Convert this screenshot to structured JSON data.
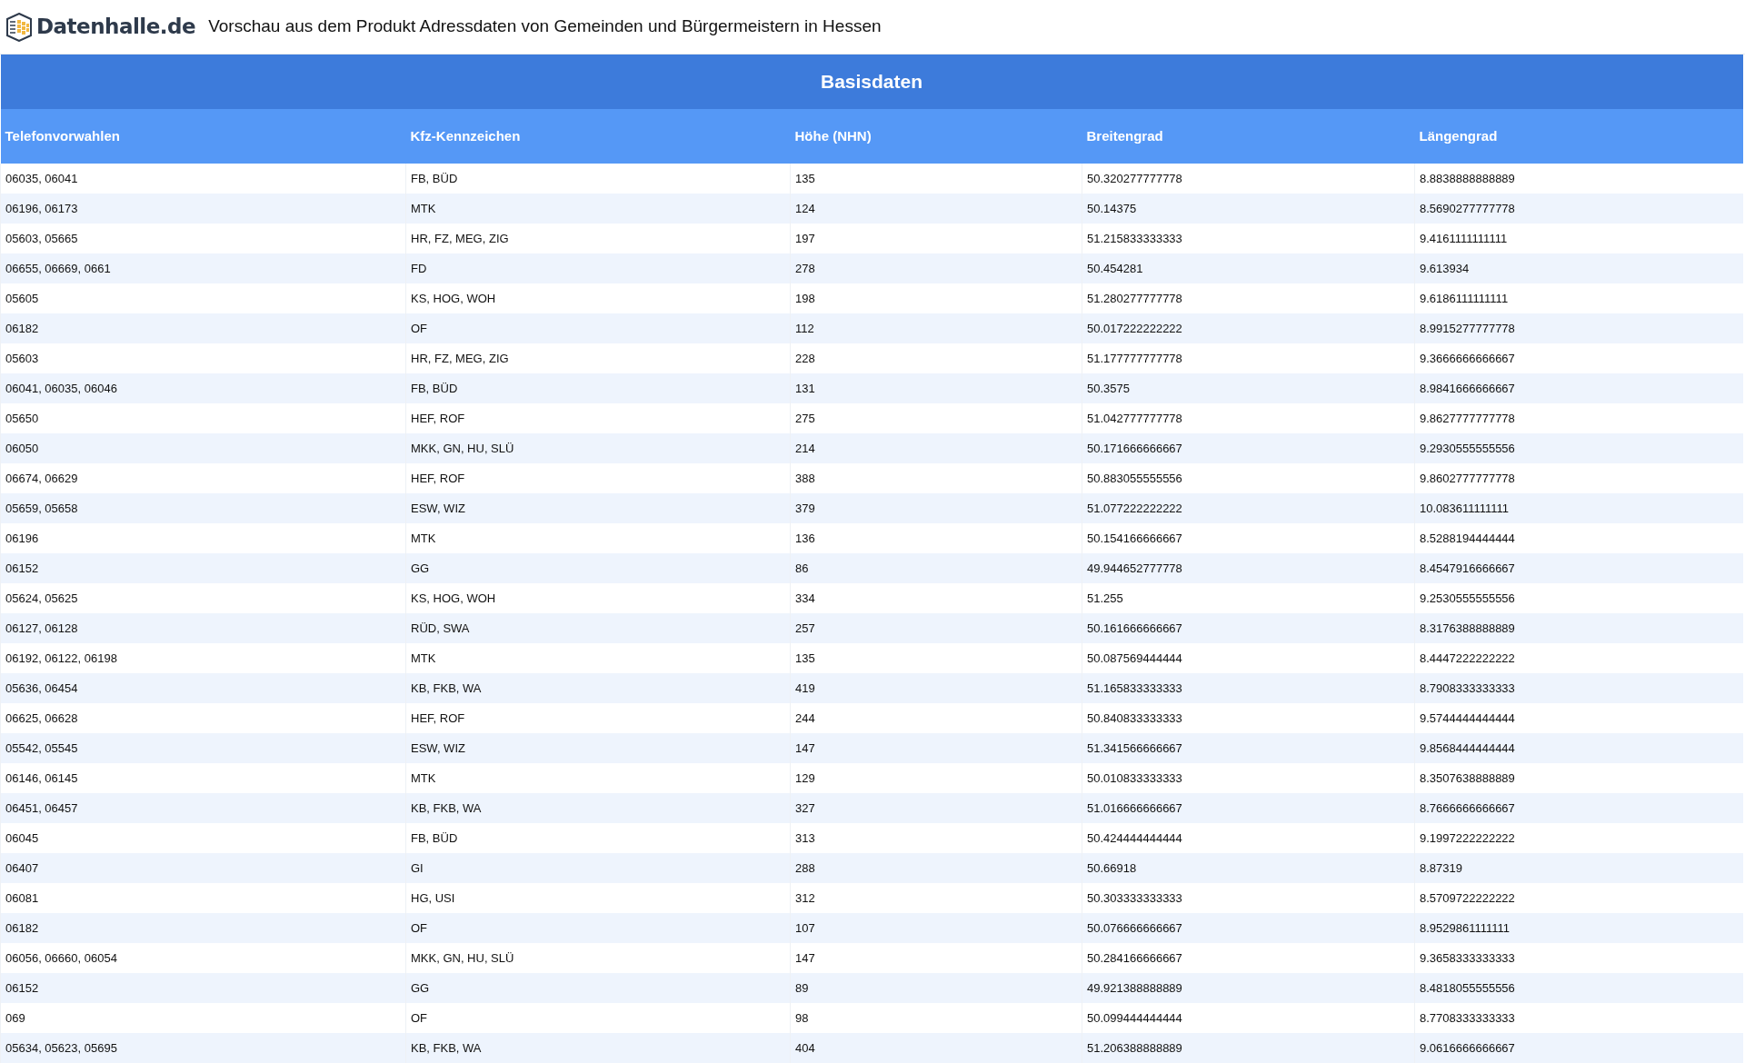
{
  "header": {
    "logo_text": "Datenhalle.de",
    "title": "Vorschau aus dem Produkt Adressdaten von Gemeinden und Bürgermeistern in Hessen"
  },
  "table": {
    "caption": "Basisdaten",
    "columns": [
      "Telefonvorwahlen",
      "Kfz-Kennzeichen",
      "Höhe (NHN)",
      "Breitengrad",
      "Längengrad"
    ],
    "rows": [
      [
        "06035, 06041",
        "FB, BÜD",
        "135",
        "50.320277777778",
        "8.8838888888889"
      ],
      [
        "06196, 06173",
        "MTK",
        "124",
        "50.14375",
        "8.5690277777778"
      ],
      [
        "05603, 05665",
        "HR, FZ, MEG, ZIG",
        "197",
        "51.215833333333",
        "9.4161111111111"
      ],
      [
        "06655, 06669, 0661",
        "FD",
        "278",
        "50.454281",
        "9.613934"
      ],
      [
        "05605",
        "KS, HOG, WOH",
        "198",
        "51.280277777778",
        "9.6186111111111"
      ],
      [
        "06182",
        "OF",
        "112",
        "50.017222222222",
        "8.9915277777778"
      ],
      [
        "05603",
        "HR, FZ, MEG, ZIG",
        "228",
        "51.177777777778",
        "9.3666666666667"
      ],
      [
        "06041, 06035, 06046",
        "FB, BÜD",
        "131",
        "50.3575",
        "8.9841666666667"
      ],
      [
        "05650",
        "HEF, ROF",
        "275",
        "51.042777777778",
        "9.8627777777778"
      ],
      [
        "06050",
        "MKK, GN, HU, SLÜ",
        "214",
        "50.171666666667",
        "9.2930555555556"
      ],
      [
        "06674, 06629",
        "HEF, ROF",
        "388",
        "50.883055555556",
        "9.8602777777778"
      ],
      [
        "05659, 05658",
        "ESW, WIZ",
        "379",
        "51.077222222222",
        "10.083611111111"
      ],
      [
        "06196",
        "MTK",
        "136",
        "50.154166666667",
        "8.5288194444444"
      ],
      [
        "06152",
        "GG",
        "86",
        "49.944652777778",
        "8.4547916666667"
      ],
      [
        "05624, 05625",
        "KS, HOG, WOH",
        "334",
        "51.255",
        "9.2530555555556"
      ],
      [
        "06127, 06128",
        "RÜD, SWA",
        "257",
        "50.161666666667",
        "8.3176388888889"
      ],
      [
        "06192, 06122, 06198",
        "MTK",
        "135",
        "50.087569444444",
        "8.4447222222222"
      ],
      [
        "05636, 06454",
        "KB, FKB, WA",
        "419",
        "51.165833333333",
        "8.7908333333333"
      ],
      [
        "06625, 06628",
        "HEF, ROF",
        "244",
        "50.840833333333",
        "9.5744444444444"
      ],
      [
        "05542, 05545",
        "ESW, WIZ",
        "147",
        "51.341566666667",
        "9.8568444444444"
      ],
      [
        "06146, 06145",
        "MTK",
        "129",
        "50.010833333333",
        "8.3507638888889"
      ],
      [
        "06451, 06457",
        "KB, FKB, WA",
        "327",
        "51.016666666667",
        "8.7666666666667"
      ],
      [
        "06045",
        "FB, BÜD",
        "313",
        "50.424444444444",
        "9.1997222222222"
      ],
      [
        "06407",
        "GI",
        "288",
        "50.66918",
        "8.87319"
      ],
      [
        "06081",
        "HG, USI",
        "312",
        "50.303333333333",
        "8.5709722222222"
      ],
      [
        "06182",
        "OF",
        "107",
        "50.076666666667",
        "8.9529861111111"
      ],
      [
        "06056, 06660, 06054",
        "MKK, GN, HU, SLÜ",
        "147",
        "50.284166666667",
        "9.3658333333333"
      ],
      [
        "06152",
        "GG",
        "89",
        "49.921388888889",
        "8.4818055555556"
      ],
      [
        "069",
        "OF",
        "98",
        "50.099444444444",
        "8.7708333333333"
      ],
      [
        "05634, 05623, 05695",
        "KB, FKB, WA",
        "404",
        "51.206388888889",
        "9.0616666666667"
      ]
    ]
  }
}
